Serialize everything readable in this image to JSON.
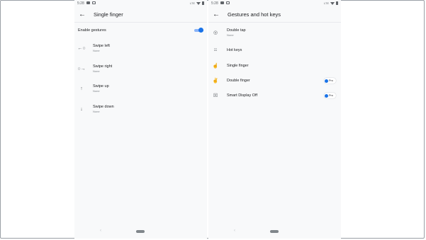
{
  "left": {
    "status": {
      "time": "5:28",
      "net": "LTE"
    },
    "title": "Single finger",
    "enable_label": "Enable gestures",
    "enabled": true,
    "items": [
      {
        "title": "Swipe left",
        "sub": "None",
        "icon": "swipe-left-icon"
      },
      {
        "title": "Swipe right",
        "sub": "None",
        "icon": "swipe-right-icon"
      },
      {
        "title": "Swipe up",
        "sub": "None",
        "icon": "swipe-up-icon"
      },
      {
        "title": "Swipe down",
        "sub": "None",
        "icon": "swipe-down-icon"
      }
    ]
  },
  "right": {
    "status": {
      "time": "5:28",
      "net": "LTE"
    },
    "title": "Gestures and hot keys",
    "items": [
      {
        "title": "Double tap",
        "sub": "None",
        "icon": "double-tap-icon"
      },
      {
        "title": "Hot keys",
        "icon": "keyboard-icon"
      },
      {
        "title": "Single finger",
        "icon": "single-finger-icon"
      },
      {
        "title": "Double finger",
        "icon": "double-finger-icon",
        "badge": "Pro"
      },
      {
        "title": "Smart Display Off",
        "icon": "display-off-icon",
        "badge": "Pro"
      }
    ]
  },
  "colors": {
    "accent": "#1a73e8",
    "background": "#f8f9fa"
  }
}
